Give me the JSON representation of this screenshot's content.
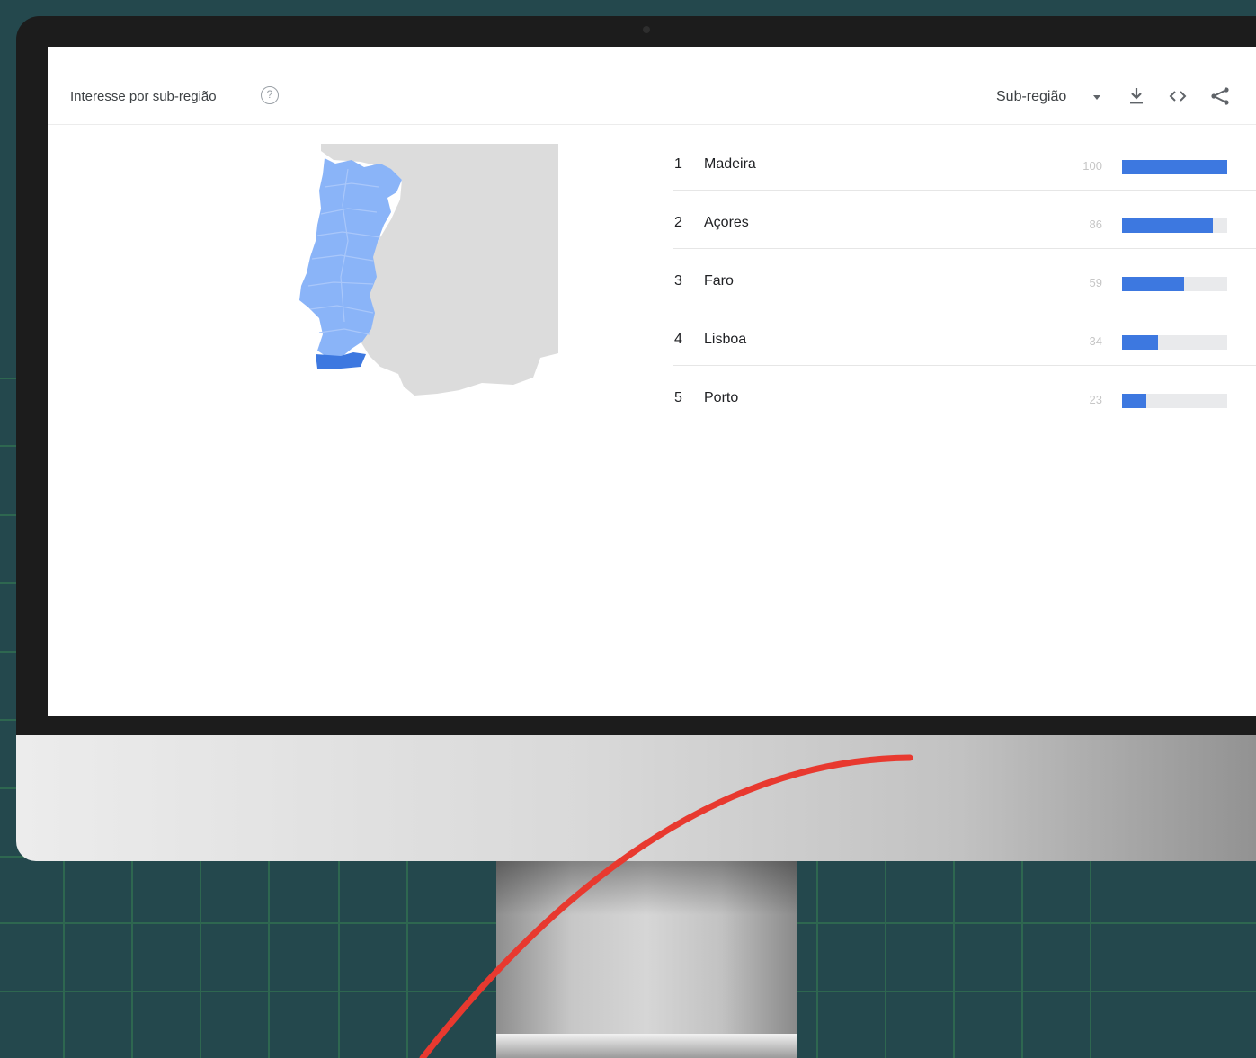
{
  "card": {
    "title": "Interesse por sub-região",
    "help_glyph": "?",
    "selector_label": "Sub-região"
  },
  "ranking": [
    {
      "rank": "1",
      "name": "Madeira",
      "value": "100",
      "value_num": 100
    },
    {
      "rank": "2",
      "name": "Açores",
      "value": "86",
      "value_num": 86
    },
    {
      "rank": "3",
      "name": "Faro",
      "value": "59",
      "value_num": 59
    },
    {
      "rank": "4",
      "name": "Lisboa",
      "value": "34",
      "value_num": 34
    },
    {
      "rank": "5",
      "name": "Porto",
      "value": "23",
      "value_num": 23
    }
  ],
  "colors": {
    "bar": "#3d78e0",
    "map_region": "#8ab4f8",
    "map_region_highlight": "#3d78e0",
    "map_background": "#dcdcdc",
    "annotation_curve": "#e8392f",
    "page_background": "#24484d"
  },
  "icons": [
    "help-icon",
    "chevron-down-icon",
    "download-icon",
    "embed-code-icon",
    "share-icon"
  ]
}
